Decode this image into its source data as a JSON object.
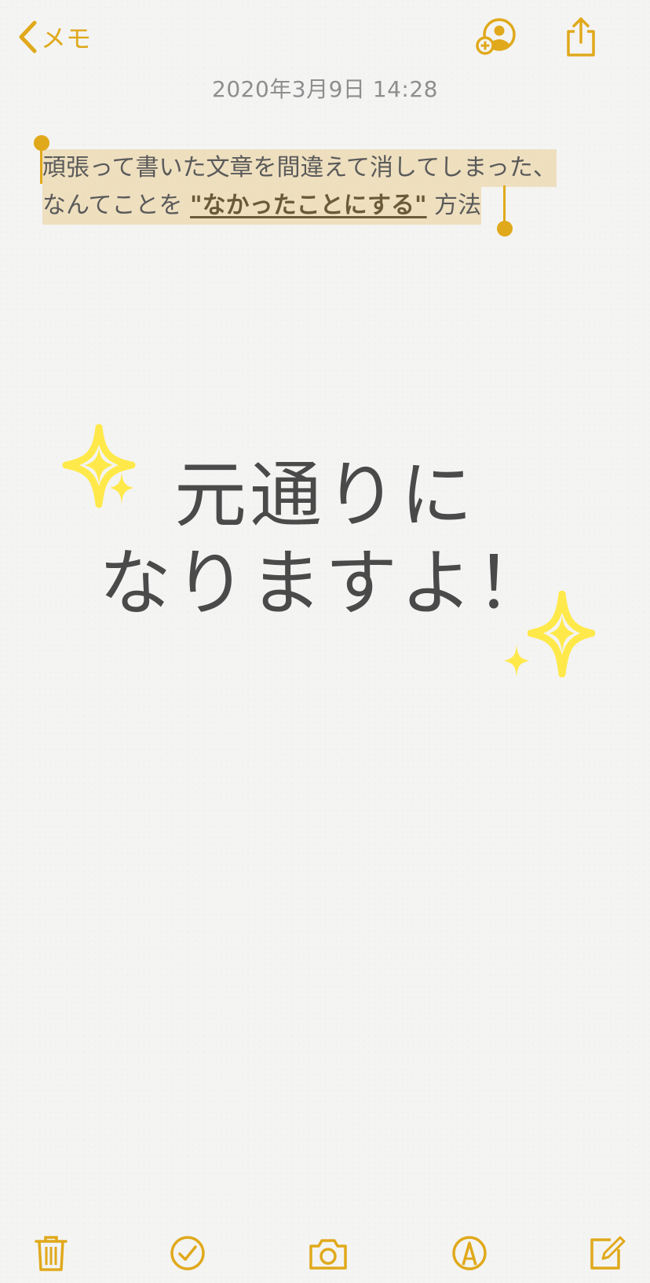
{
  "navbar": {
    "back_label": "メモ",
    "icons": [
      "chevron-left-icon",
      "add-person-icon",
      "share-icon"
    ]
  },
  "note": {
    "date": "2020年3月9日 14:28",
    "line1": "頑張って書いた文章を間違えて消してしまった、",
    "line2_prefix": "なんてことを ",
    "line2_bold": "\"なかったことにする\"",
    "line2_suffix": " 方法",
    "selection_color": "#e9ce93"
  },
  "overlay": {
    "line1": "元通りに",
    "line2": "なりますよ！",
    "sparkle_color": "#ffe94a"
  },
  "toolbar": {
    "icons": [
      "trash-icon",
      "checkmark-circle-icon",
      "camera-icon",
      "markup-pen-icon",
      "compose-icon"
    ]
  },
  "colors": {
    "accent": "#e0a91b",
    "background": "#f4f4f3",
    "text": "#5a5a5a"
  }
}
